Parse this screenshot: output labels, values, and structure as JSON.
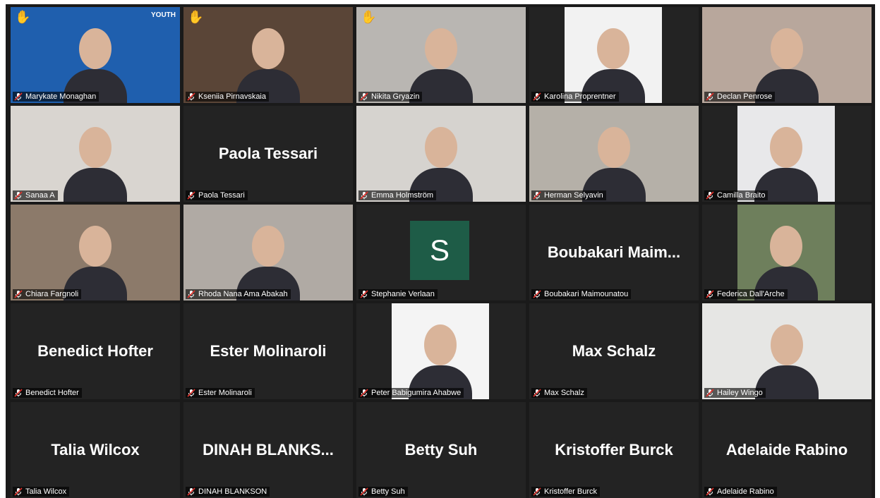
{
  "meeting": {
    "active_speaker_color": "#c5e14a",
    "participants": [
      {
        "name": "Marykate Monaghan",
        "video": true,
        "hand_raised": true,
        "bg": "#1f5fae"
      },
      {
        "name": "Kseniia Pirnavskaia",
        "video": true,
        "hand_raised": true,
        "bg": "#5a4537"
      },
      {
        "name": "Nikita Gryazin",
        "video": true,
        "hand_raised": true,
        "bg": "#b9b6b2"
      },
      {
        "name": "Karolina Proprentner",
        "video": true,
        "hand_raised": false,
        "bg": "#f2f2f2"
      },
      {
        "name": "Declan Penrose",
        "video": true,
        "hand_raised": false,
        "active": true,
        "bg": "#b8a79c"
      },
      {
        "name": "Sanaa A",
        "video": true,
        "hand_raised": false,
        "bg": "#d9d5d0"
      },
      {
        "name": "Paola Tessari",
        "video": false,
        "display_name": "Paola Tessari"
      },
      {
        "name": "Emma Holmström",
        "video": true,
        "hand_raised": false,
        "bg": "#d6d3cf"
      },
      {
        "name": "Herman Selyavin",
        "video": true,
        "hand_raised": false,
        "bg": "#b5b0a8"
      },
      {
        "name": "Camilla Braito",
        "video": true,
        "hand_raised": false,
        "bg": "#e8e8ea"
      },
      {
        "name": "Chiara Fargnoli",
        "video": true,
        "hand_raised": false,
        "bg": "#8c7a6a"
      },
      {
        "name": "Rhoda Nana Ama Abakah",
        "video": true,
        "hand_raised": false,
        "bg": "#b0aaa4"
      },
      {
        "name": "Stephanie Verlaan",
        "video": false,
        "avatar_letter": "S"
      },
      {
        "name": "Boubakari Maimounatou",
        "video": false,
        "display_name": "Boubakari  Maim..."
      },
      {
        "name": "Federica Dall'Arche",
        "video": true,
        "hand_raised": false,
        "bg": "#6e7f5c"
      },
      {
        "name": "Benedict Hofter",
        "video": false,
        "display_name": "Benedict Hofter"
      },
      {
        "name": "Ester Molinaroli",
        "video": false,
        "display_name": "Ester Molinaroli"
      },
      {
        "name": "Peter Babigumira Ahabwe",
        "video": true,
        "hand_raised": false,
        "bg": "#f4f4f4"
      },
      {
        "name": "Max Schalz",
        "video": false,
        "display_name": "Max Schalz"
      },
      {
        "name": "Hailey Wingo",
        "video": true,
        "hand_raised": false,
        "bg": "#e6e6e4"
      },
      {
        "name": "Talia Wilcox",
        "video": false,
        "display_name": "Talia Wilcox"
      },
      {
        "name": "DINAH BLANKSON",
        "video": false,
        "display_name": "DINAH  BLANKS..."
      },
      {
        "name": "Betty Suh",
        "video": false,
        "display_name": "Betty Suh"
      },
      {
        "name": "Kristoffer Burck",
        "video": false,
        "display_name": "Kristoffer Burck"
      },
      {
        "name": "Adelaide Rabino",
        "video": false,
        "display_name": "Adelaide Rabino"
      }
    ]
  },
  "logo_text": "YOUTH"
}
